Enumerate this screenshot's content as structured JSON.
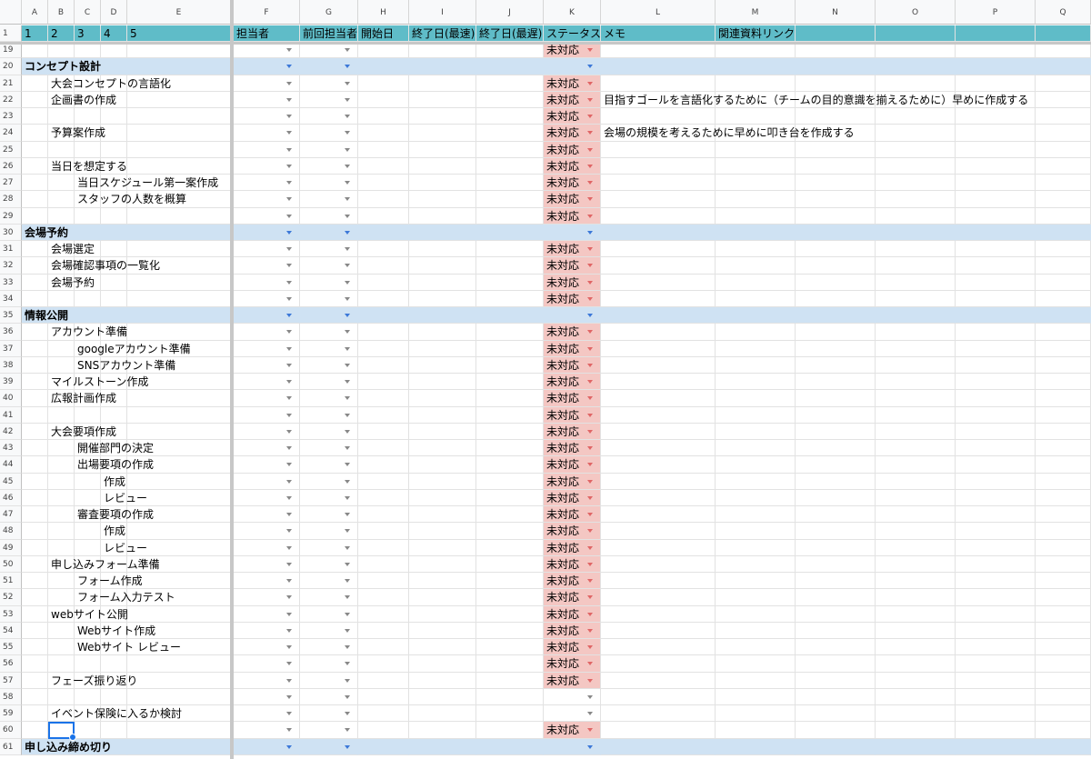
{
  "columns": [
    "A",
    "B",
    "C",
    "D",
    "E",
    "F",
    "G",
    "H",
    "I",
    "J",
    "K",
    "L",
    "M",
    "N",
    "O",
    "P",
    "Q"
  ],
  "header_row": {
    "num": "1",
    "cells": {
      "A": "1",
      "B": "2",
      "C": "3",
      "D": "4",
      "E": "5",
      "F": "担当者",
      "G": "前回担当者",
      "H": "開始日",
      "I": "終了日(最速)",
      "J": "終了日(最遅)",
      "K": "ステータス",
      "L": "メモ",
      "M": "関連資料リンク"
    }
  },
  "status_value": "未対応",
  "rows": [
    {
      "num": "19",
      "level": 0,
      "text": "",
      "type": "task",
      "status": true
    },
    {
      "num": "20",
      "level": 0,
      "text": "コンセプト設計",
      "type": "section"
    },
    {
      "num": "21",
      "level": 1,
      "text": "大会コンセプトの言語化",
      "type": "task",
      "status": true
    },
    {
      "num": "22",
      "level": 1,
      "text": "企画書の作成",
      "type": "task",
      "status": true,
      "memo": "目指すゴールを言語化するために（チームの目的意識を揃えるために）早めに作成する"
    },
    {
      "num": "23",
      "level": 0,
      "text": "",
      "type": "task",
      "status": true
    },
    {
      "num": "24",
      "level": 1,
      "text": "予算案作成",
      "type": "task",
      "status": true,
      "memo": "会場の規模を考えるために早めに叩き台を作成する"
    },
    {
      "num": "25",
      "level": 0,
      "text": "",
      "type": "task",
      "status": true
    },
    {
      "num": "26",
      "level": 1,
      "text": "当日を想定する",
      "type": "task",
      "status": true
    },
    {
      "num": "27",
      "level": 2,
      "text": "当日スケジュール第一案作成",
      "type": "task",
      "status": true
    },
    {
      "num": "28",
      "level": 2,
      "text": "スタッフの人数を概算",
      "type": "task",
      "status": true
    },
    {
      "num": "29",
      "level": 0,
      "text": "",
      "type": "task",
      "status": true
    },
    {
      "num": "30",
      "level": 0,
      "text": "会場予約",
      "type": "section"
    },
    {
      "num": "31",
      "level": 1,
      "text": "会場選定",
      "type": "task",
      "status": true
    },
    {
      "num": "32",
      "level": 1,
      "text": "会場確認事項の一覧化",
      "type": "task",
      "status": true
    },
    {
      "num": "33",
      "level": 1,
      "text": "会場予約",
      "type": "task",
      "status": true
    },
    {
      "num": "34",
      "level": 0,
      "text": "",
      "type": "task",
      "status": true
    },
    {
      "num": "35",
      "level": 0,
      "text": "情報公開",
      "type": "section"
    },
    {
      "num": "36",
      "level": 1,
      "text": "アカウント準備",
      "type": "task",
      "status": true
    },
    {
      "num": "37",
      "level": 2,
      "text": "googleアカウント準備",
      "type": "task",
      "status": true
    },
    {
      "num": "38",
      "level": 2,
      "text": "SNSアカウント準備",
      "type": "task",
      "status": true
    },
    {
      "num": "39",
      "level": 1,
      "text": "マイルストーン作成",
      "type": "task",
      "status": true
    },
    {
      "num": "40",
      "level": 1,
      "text": "広報計画作成",
      "type": "task",
      "status": true
    },
    {
      "num": "41",
      "level": 0,
      "text": "",
      "type": "task",
      "status": true
    },
    {
      "num": "42",
      "level": 1,
      "text": "大会要項作成",
      "type": "task",
      "status": true
    },
    {
      "num": "43",
      "level": 2,
      "text": "開催部門の決定",
      "type": "task",
      "status": true
    },
    {
      "num": "44",
      "level": 2,
      "text": "出場要項の作成",
      "type": "task",
      "status": true
    },
    {
      "num": "45",
      "level": 3,
      "text": "作成",
      "type": "task",
      "status": true
    },
    {
      "num": "46",
      "level": 3,
      "text": "レビュー",
      "type": "task",
      "status": true
    },
    {
      "num": "47",
      "level": 2,
      "text": "審査要項の作成",
      "type": "task",
      "status": true
    },
    {
      "num": "48",
      "level": 3,
      "text": "作成",
      "type": "task",
      "status": true
    },
    {
      "num": "49",
      "level": 3,
      "text": "レビュー",
      "type": "task",
      "status": true
    },
    {
      "num": "50",
      "level": 1,
      "text": "申し込みフォーム準備",
      "type": "task",
      "status": true
    },
    {
      "num": "51",
      "level": 2,
      "text": "フォーム作成",
      "type": "task",
      "status": true
    },
    {
      "num": "52",
      "level": 2,
      "text": "フォーム入力テスト",
      "type": "task",
      "status": true
    },
    {
      "num": "53",
      "level": 1,
      "text": "webサイト公開",
      "type": "task",
      "status": true
    },
    {
      "num": "54",
      "level": 2,
      "text": "Webサイト作成",
      "type": "task",
      "status": true
    },
    {
      "num": "55",
      "level": 2,
      "text": "Webサイト レビュー",
      "type": "task",
      "status": true
    },
    {
      "num": "56",
      "level": 0,
      "text": "",
      "type": "task",
      "status": true
    },
    {
      "num": "57",
      "level": 1,
      "text": "フェーズ振り返り",
      "type": "task",
      "status": true
    },
    {
      "num": "58",
      "level": 0,
      "text": "",
      "type": "task",
      "status": false
    },
    {
      "num": "59",
      "level": 1,
      "text": "イベント保険に入るか検討",
      "type": "task",
      "status": false
    },
    {
      "num": "60",
      "level": 0,
      "text": "",
      "type": "task",
      "status": true,
      "selected": true
    },
    {
      "num": "61",
      "level": 0,
      "text": "申し込み締め切り",
      "type": "section"
    }
  ],
  "colors": {
    "header_teal": "#5fbcc8",
    "section_blue": "#cfe2f3",
    "status_red": "#f4c7c3",
    "select_blue": "#1a73e8"
  }
}
